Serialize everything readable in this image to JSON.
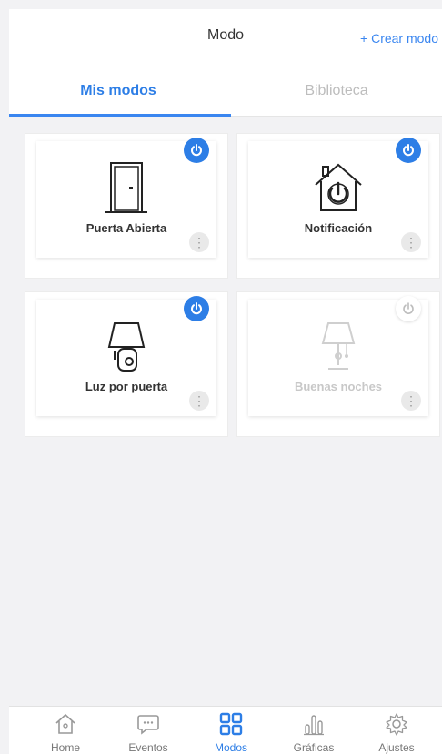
{
  "header": {
    "title": "Modo",
    "create_label": "+ Crear modo"
  },
  "tabs": [
    {
      "label": "Mis modos",
      "active": true
    },
    {
      "label": "Biblioteca",
      "active": false
    }
  ],
  "modes": [
    {
      "label": "Puerta Abierta",
      "icon": "door-icon",
      "on": true
    },
    {
      "label": "Notificación",
      "icon": "home-power-icon",
      "on": true
    },
    {
      "label": "Luz por puerta",
      "icon": "lamp-icon",
      "on": true
    },
    {
      "label": "Buenas noches",
      "icon": "night-lamp-icon",
      "on": false
    }
  ],
  "bottom_nav": [
    {
      "label": "Home",
      "icon": "home-icon",
      "active": false
    },
    {
      "label": "Eventos",
      "icon": "chat-icon",
      "active": false
    },
    {
      "label": "Modos",
      "icon": "grid-icon",
      "active": true
    },
    {
      "label": "Gráficas",
      "icon": "bar-chart-icon",
      "active": false
    },
    {
      "label": "Ajustes",
      "icon": "gear-icon",
      "active": false
    }
  ],
  "colors": {
    "accent": "#2d7ee6",
    "inactive_text": "#bdbdbd"
  }
}
